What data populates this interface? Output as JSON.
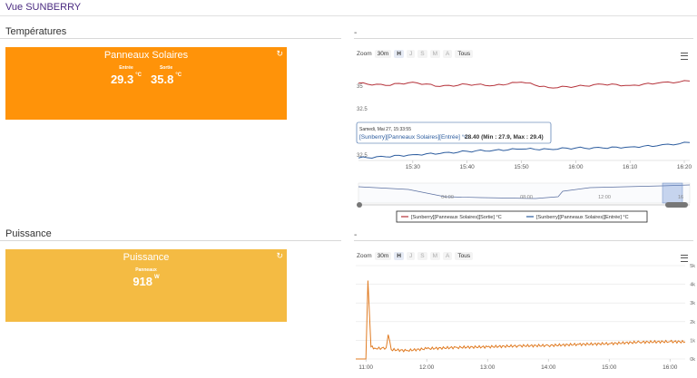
{
  "page": {
    "title": "Vue SUNBERRY"
  },
  "temp_section": {
    "title": "Températures",
    "dash": "-"
  },
  "power_section": {
    "title": "Puissance",
    "dash": "-"
  },
  "temp_widget": {
    "title": "Panneaux Solaires",
    "in_label": "Entrée",
    "in_value": "29.3",
    "in_unit": "°C",
    "out_label": "Sortie",
    "out_value": "35.8",
    "out_unit": "°C",
    "color": "#ff9309"
  },
  "power_widget": {
    "title": "Puissance",
    "label": "Panneaux",
    "value": "918",
    "unit": "W",
    "color": "#f4bb43"
  },
  "temp_chart": {
    "zoom_label": "Zoom",
    "zoom_buttons": [
      "30m",
      "H",
      "J",
      "S",
      "M",
      "A",
      "Tous"
    ],
    "zoom_selected": "H",
    "tooltip_date": "Samedi, Mai 27, 15:33:55",
    "tooltip_series": "[Sunberry][Panneaux Solaires][Entrée] °C",
    "tooltip_value": "28.40 (Min : 27.9, Max : 29.4)",
    "legend": [
      "[Sunberry][Panneaux Solaires][Sortie] °C",
      "[Sunberry][Panneaux Solaires][Entrée] °C"
    ],
    "navigator_ticks": [
      "04:00",
      "08:00",
      "12:00",
      "16"
    ]
  },
  "power_chart": {
    "zoom_label": "Zoom",
    "zoom_buttons": [
      "30m",
      "H",
      "J",
      "S",
      "M",
      "A",
      "Tous"
    ],
    "zoom_selected": "H"
  },
  "chart_data": [
    {
      "type": "line",
      "x_ticks": [
        "15:30",
        "15:40",
        "15:50",
        "16:00",
        "16:10",
        "16:20"
      ],
      "y_ticks": [
        "35",
        "32.5",
        "32.5"
      ],
      "series": [
        {
          "name": "[Sunberry][Panneaux Solaires][Sortie] °C",
          "color": "#b5323a",
          "x": [
            "15:20",
            "15:25",
            "15:30",
            "15:35",
            "15:40",
            "15:45",
            "15:50",
            "15:55",
            "16:00",
            "16:05",
            "16:10",
            "16:15",
            "16:21"
          ],
          "values": [
            35.6,
            35.4,
            35.7,
            35.3,
            35.5,
            35.4,
            35.7,
            35.2,
            35.3,
            35.5,
            35.4,
            35.6,
            35.8
          ]
        },
        {
          "name": "[Sunberry][Panneaux Solaires][Entrée] °C",
          "color": "#2c5c9e",
          "x": [
            "15:20",
            "15:25",
            "15:30",
            "15:35",
            "15:40",
            "15:45",
            "15:50",
            "15:55",
            "16:00",
            "16:05",
            "16:10",
            "16:15",
            "16:21"
          ],
          "values": [
            27.9,
            28.0,
            28.2,
            28.3,
            28.5,
            28.6,
            28.7,
            28.7,
            28.8,
            28.8,
            28.9,
            29.0,
            29.3
          ]
        }
      ]
    },
    {
      "type": "line",
      "x_ticks": [
        "11:00",
        "12:00",
        "13:00",
        "14:00",
        "15:00",
        "16:00"
      ],
      "y_ticks": [
        "0k",
        "1k",
        "2k",
        "3k",
        "4k",
        "5k"
      ],
      "ylim": [
        0,
        5000
      ],
      "series": [
        {
          "name": "",
          "color": "#e07b22",
          "x": [
            "10:50",
            "11:00",
            "11:02",
            "11:05",
            "11:10",
            "11:20",
            "11:22",
            "11:25",
            "11:40",
            "12:00",
            "12:30",
            "13:00",
            "13:30",
            "14:00",
            "14:30",
            "15:00",
            "15:30",
            "16:00",
            "16:15"
          ],
          "values": [
            0,
            0,
            4200,
            650,
            550,
            600,
            1300,
            500,
            450,
            550,
            620,
            650,
            700,
            720,
            780,
            820,
            900,
            930,
            918
          ]
        }
      ]
    }
  ]
}
